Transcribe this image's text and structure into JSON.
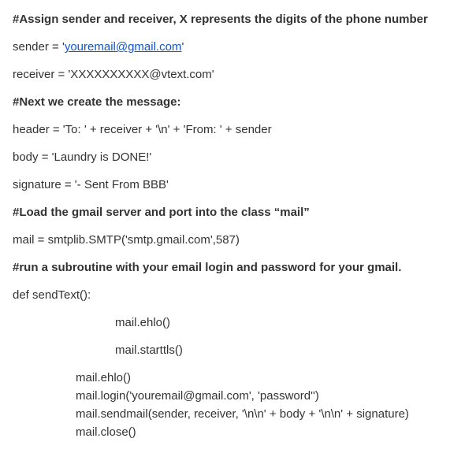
{
  "lines": {
    "c1": "#Assign sender and receiver, X represents the digits of the phone number",
    "l1a": "sender = '",
    "l1b": "youremail@gmail.com",
    "l1c": "'",
    "l2": "receiver = 'XXXXXXXXXX@vtext.com'",
    "c2": "#Next we create the message:",
    "l3": "header = 'To: ' + receiver + '\\n' + 'From: ' + sender",
    "l4": "body = 'Laundry is DONE!'",
    "l5": "signature = '- Sent From BBB'",
    "c3": "#Load the gmail server and port into the class “mail”",
    "l6": "mail = smtplib.SMTP('smtp.gmail.com',587)",
    "c4": "#run a subroutine with your email login and password for your gmail.",
    "l7": "def sendText():",
    "l8": "mail.ehlo()",
    "l9": "mail.starttls()",
    "l10": "mail.ehlo()",
    "l11": "mail.login('youremail@gmail.com', 'password'')",
    "l12": "mail.sendmail(sender, receiver, '\\n\\n' + body + '\\n\\n' + signature)",
    "l13": "mail.close()"
  }
}
